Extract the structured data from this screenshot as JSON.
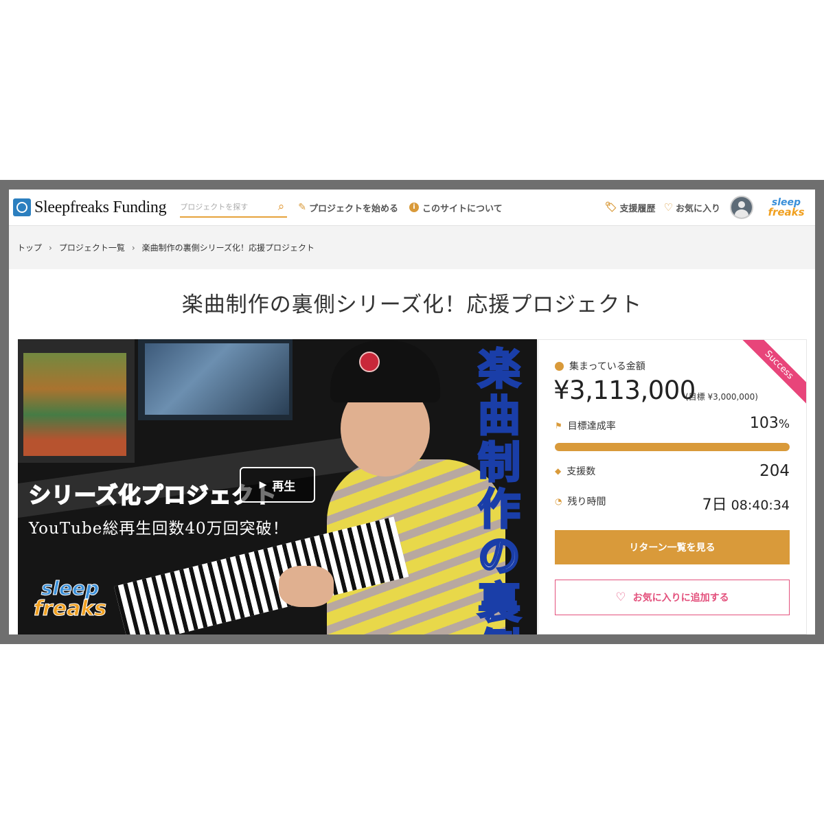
{
  "header": {
    "brand": "Sleepfreaks Funding",
    "search_placeholder": "プロジェクトを探す",
    "nav_start": "プロジェクトを始める",
    "nav_about": "このサイトについて",
    "nav_history": "支援履歴",
    "nav_favorites": "お気に入り",
    "logo_line1": "sleep",
    "logo_line2": "freaks"
  },
  "breadcrumb": [
    "トップ",
    "プロジェクト一覧",
    "楽曲制作の裏側シリーズ化！応援プロジェクト"
  ],
  "page_title": "楽曲制作の裏側シリーズ化！応援プロジェクト",
  "hero": {
    "overlay_title": "シリーズ化プロジェクト",
    "overlay_subtitle": "YouTube総再生回数40万回突破！",
    "play_label": "再生",
    "vertical_title": "楽曲制作の裏側",
    "logo_line1": "sleep",
    "logo_line2": "freaks"
  },
  "stats": {
    "ribbon": "Success",
    "raised_label": "集まっている金額",
    "raised_amount": "¥3,113,000",
    "goal_text": "(目標 ¥3,000,000)",
    "rate_label": "目標達成率",
    "rate_value": "103",
    "rate_unit": "%",
    "progress_fraction": 1.0,
    "backers_label": "支援数",
    "backers_value": "204",
    "time_label": "残り時間",
    "time_days": "7日",
    "time_clock": "08:40:34",
    "returns_button": "リターン一覧を見る",
    "favorite_button": "お気に入りに追加する"
  },
  "colors": {
    "accent": "#d99a3a",
    "pink": "#e3507c",
    "brand_blue": "#2b7fbf"
  }
}
